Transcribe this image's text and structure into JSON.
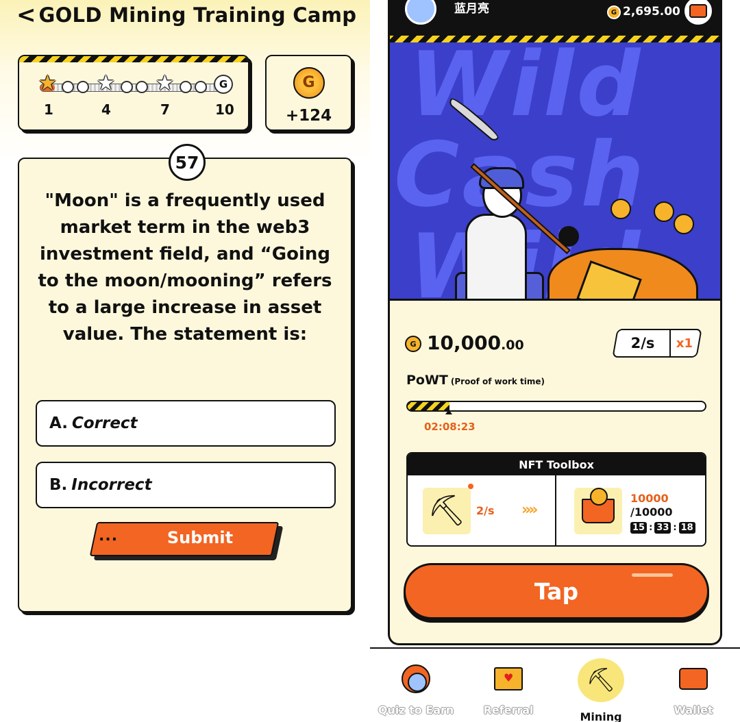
{
  "left": {
    "header": {
      "back_glyph": "<",
      "title": "GOLD Mining Training Camp"
    },
    "progress": {
      "levels": [
        "1",
        "4",
        "7",
        "10"
      ],
      "progress_fraction": 0.08,
      "end_icon": "g-coin-icon"
    },
    "reward": {
      "icon": "gold-coin-icon",
      "value": "+124"
    },
    "quiz": {
      "number": "57",
      "question": "\"Moon\" is a frequently used market term in the web3 investment field, and “Going to the moon/mooning” refers to a large increase in asset value. The statement is:",
      "options": [
        {
          "letter": "A.",
          "text": "Correct"
        },
        {
          "letter": "B.",
          "text": "Incorrect"
        }
      ],
      "submit_dots": "...",
      "submit_label": "Submit"
    }
  },
  "right": {
    "topbar": {
      "username": "蓝月亮",
      "balance": "2,695.00",
      "wallet_icon": "wallet-icon"
    },
    "banner": {
      "background_text": [
        "Wild",
        "Cash",
        "Wild"
      ]
    },
    "mining": {
      "amount_main": "10,000",
      "amount_decimal": ".00",
      "rate": "2/s",
      "multiplier": "x1"
    },
    "powt": {
      "label": "PoWT",
      "sublabel": "(Proof of work time)",
      "progress_fraction": 0.14,
      "time": "02:08:23"
    },
    "toolbox": {
      "title": "NFT Toolbox",
      "tool_rate": "2/s",
      "arrow": "»»",
      "capacity_current": "10000",
      "capacity_total": "/10000",
      "timer": [
        "15",
        "33",
        "18"
      ]
    },
    "tap_label": "Tap",
    "nav": [
      {
        "label": "Quiz to Earn",
        "icon": "avatar-icon",
        "active": false
      },
      {
        "label": "Referral",
        "icon": "envelope-heart-icon",
        "active": false
      },
      {
        "label": "Mining",
        "icon": "pickaxe-icon",
        "active": true
      },
      {
        "label": "Wallet",
        "icon": "wallet-icon",
        "active": false
      }
    ]
  },
  "colors": {
    "accent": "#f26522",
    "gold": "#f7b32b",
    "cream": "#fdf8dc",
    "banner": "#3b3fc9"
  }
}
